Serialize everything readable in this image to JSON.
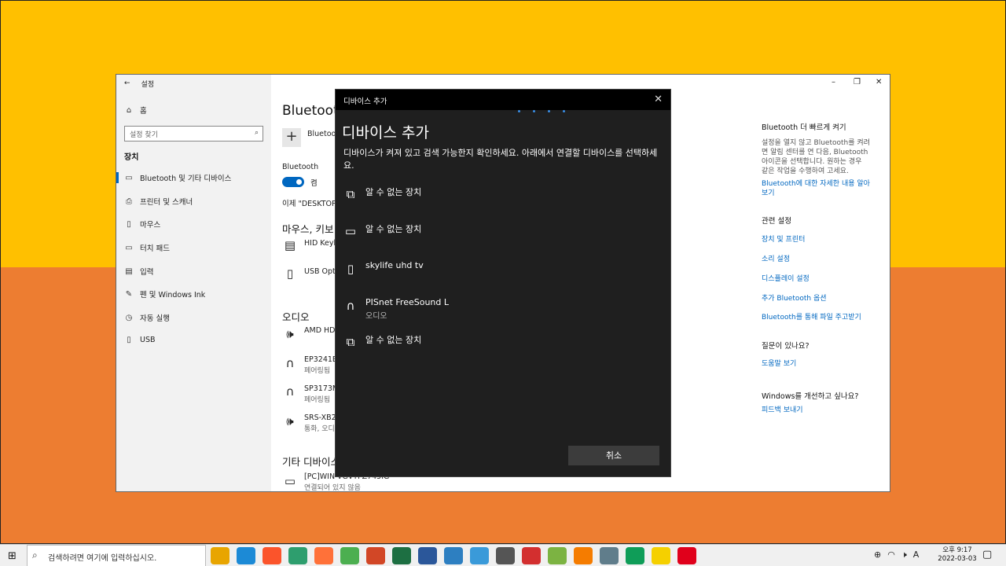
{
  "settings": {
    "title": "설정",
    "sidebar": {
      "home": "홈",
      "search_placeholder": "설정 찾기",
      "section": "장치",
      "items": [
        {
          "label": "Bluetooth 및 기타 디바이스",
          "icon": "bluetooth-icon"
        },
        {
          "label": "프린터 및 스캐너",
          "icon": "printer-icon"
        },
        {
          "label": "마우스",
          "icon": "mouse-icon"
        },
        {
          "label": "터치 패드",
          "icon": "touchpad-icon"
        },
        {
          "label": "입력",
          "icon": "keyboard-icon"
        },
        {
          "label": "펜 및 Windows Ink",
          "icon": "pen-icon"
        },
        {
          "label": "자동 실행",
          "icon": "autoplay-icon"
        },
        {
          "label": "USB",
          "icon": "usb-icon"
        }
      ]
    },
    "main": {
      "title": "Bluetooth",
      "add_label": "Bluetooth",
      "bt_label": "Bluetooth",
      "toggle_label": "켬",
      "discoverable": "이제 \"DESKTOP-",
      "section_mouse": "마우스, 키보",
      "mouse_devices": [
        {
          "name": "HID Keyb",
          "icon": "keyboard-icon"
        },
        {
          "name": "USB Opti",
          "icon": "mouse-icon"
        }
      ],
      "section_audio": "오디오",
      "audio_devices": [
        {
          "name": "AMD HD",
          "sub": "",
          "icon": "speaker-icon"
        },
        {
          "name": "EP3241BT",
          "sub": "페어링됨",
          "icon": "headphones-icon"
        },
        {
          "name": "SP3173M",
          "sub": "페어링됨",
          "icon": "headset-icon"
        },
        {
          "name": "SRS-XB20",
          "sub": "통화, 오디",
          "icon": "speaker-icon"
        }
      ],
      "section_other": "기타 디바이스",
      "other_devices": [
        {
          "name": "[PC]WIN-VGVTFZ745IG",
          "sub": "연결되어 있지 않음",
          "icon": "pc-icon"
        }
      ]
    },
    "right": {
      "quick_heading": "Bluetooth 더 빠르게 켜기",
      "quick_text": [
        "설정을 열지 않고 Bluetooth를 켜려",
        "면 알림 센터를 연 다음, Bluetooth",
        "아이콘을 선택합니다. 원하는 경우",
        "같은 작업을 수행하여 고세요."
      ],
      "quick_link": [
        "Bluetooth에 대한 자세한 내용 알아",
        "보기"
      ],
      "related_heading": "관련 설정",
      "related_links": [
        "장치 및 프린터",
        "소리 설정",
        "디스플레이 설정",
        "추가 Bluetooth 옵션",
        "Bluetooth를 통해 파일 주고받기"
      ],
      "question_heading": "질문이 있나요?",
      "question_link": "도움말 보기",
      "improve_heading": "Windows를 개선하고 싶나요?",
      "improve_link": "피드백 보내기"
    }
  },
  "dialog": {
    "titlebar": "디바이스 추가",
    "heading": "디바이스 추가",
    "description": "디바이스가 켜져 있고 검색 가능한지 확인하세요. 아래에서 연결할 디바이스를 선택하세요.",
    "devices": [
      {
        "name": "알 수 없는 장치",
        "sub": "",
        "icon": "unknown-device-icon"
      },
      {
        "name": "알 수 없는 장치",
        "sub": "",
        "icon": "monitor-icon"
      },
      {
        "name": "skylife uhd tv",
        "sub": "",
        "icon": "phone-icon"
      },
      {
        "name": "PISnet FreeSound L",
        "sub": "오디오",
        "icon": "headphones-icon"
      },
      {
        "name": "알 수 없는 장치",
        "sub": "",
        "icon": "unknown-device-icon"
      }
    ],
    "cancel": "취소"
  },
  "taskbar": {
    "search_placeholder": "검색하려면 여기에 입력하십시오.",
    "apps": [
      {
        "icon": "file-explorer-icon",
        "color": "#e8a500"
      },
      {
        "icon": "edge-icon",
        "color": "#1c8ad6"
      },
      {
        "icon": "brave-icon",
        "color": "#fb542b"
      },
      {
        "icon": "sync-icon",
        "color": "#2e9e6e"
      },
      {
        "icon": "firefox-icon",
        "color": "#ff7139"
      },
      {
        "icon": "chrome-icon",
        "color": "#4caf50"
      },
      {
        "icon": "powerpoint-icon",
        "color": "#d24726"
      },
      {
        "icon": "excel-icon",
        "color": "#1d6f42"
      },
      {
        "icon": "word-icon",
        "color": "#2b579a"
      },
      {
        "icon": "hwp-icon",
        "color": "#2d7fc1"
      },
      {
        "icon": "remote-desktop-icon",
        "color": "#3a9ad9"
      },
      {
        "icon": "magnifier-tool-icon",
        "color": "#555555"
      },
      {
        "icon": "se-icon",
        "color": "#d32f2f"
      },
      {
        "icon": "android-icon",
        "color": "#7cb342"
      },
      {
        "icon": "vlc-icon",
        "color": "#f57c00"
      },
      {
        "icon": "calculator-icon",
        "color": "#607d8b"
      },
      {
        "icon": "edge-dev-icon",
        "color": "#0f9d58"
      },
      {
        "icon": "sticky-notes-icon",
        "color": "#f5d000"
      },
      {
        "icon": "opera-icon",
        "color": "#e0001b"
      }
    ],
    "time": "오후 9:17",
    "date": "2022-03-03",
    "ime": "A"
  }
}
